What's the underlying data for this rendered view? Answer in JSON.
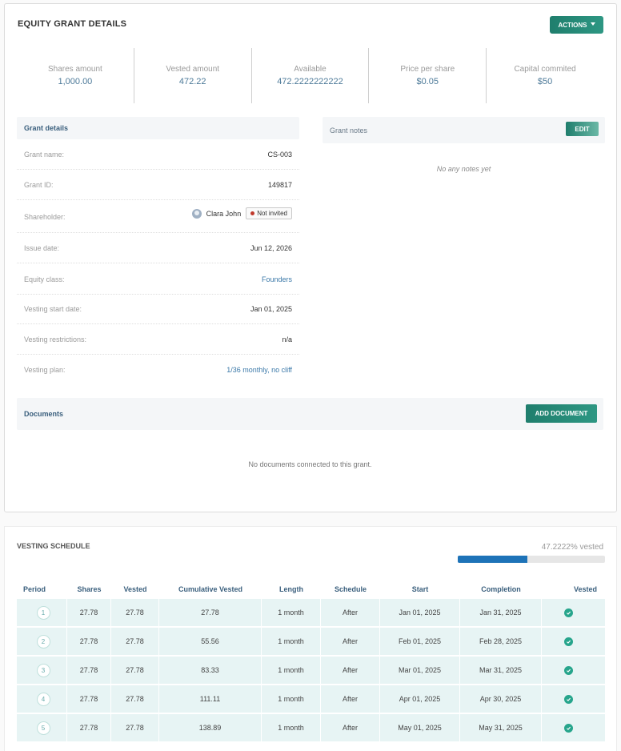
{
  "grant": {
    "title": "EQUITY GRANT DETAILS",
    "actions_label": "ACTIONS",
    "stats": [
      {
        "label": "Shares amount",
        "value": "1,000.00"
      },
      {
        "label": "Vested amount",
        "value": "472.22"
      },
      {
        "label": "Available",
        "value": "472.2222222222"
      },
      {
        "label": "Price per share",
        "value": "$0.05"
      },
      {
        "label": "Capital commited",
        "value": "$50"
      }
    ]
  },
  "details": {
    "title": "Grant details",
    "rows": {
      "name": {
        "label": "Grant name:",
        "value": "CS-003"
      },
      "id": {
        "label": "Grant ID:",
        "value": "149817"
      },
      "shareholder": {
        "label": "Shareholder:",
        "value": "Clara John",
        "badge": "Not invited"
      },
      "issue_date": {
        "label": "Issue date:",
        "value": "Jun 12, 2026"
      },
      "equity_class": {
        "label": "Equity class:",
        "value": "Founders"
      },
      "vesting_start": {
        "label": "Vesting start date:",
        "value": "Jan 01, 2025"
      },
      "vesting_restrictions": {
        "label": "Vesting restrictions:",
        "value": "n/a"
      },
      "vesting_plan": {
        "label": "Vesting plan:",
        "value": "1/36 monthly, no cliff"
      }
    }
  },
  "notes": {
    "title": "Grant notes",
    "edit_label": "EDIT",
    "empty_text": "No any notes yet"
  },
  "documents": {
    "title": "Documents",
    "add_label": "ADD DOCUMENT",
    "empty_text": "No documents connected to this grant."
  },
  "vesting": {
    "title": "VESTING SCHEDULE",
    "percent_label": "47.2222% vested",
    "progress": 0.472222,
    "columns": {
      "period": "Period",
      "shares": "Shares",
      "vested": "Vested",
      "cumulative": "Cumulative Vested",
      "length": "Length",
      "schedule": "Schedule",
      "start": "Start",
      "completion": "Completion",
      "vested_flag": "Vested"
    },
    "rows": [
      {
        "period": "1",
        "shares": "27.78",
        "vested": "27.78",
        "cumulative": "27.78",
        "length": "1 month",
        "schedule": "After",
        "start": "Jan 01, 2025",
        "completion": "Jan 31, 2025"
      },
      {
        "period": "2",
        "shares": "27.78",
        "vested": "27.78",
        "cumulative": "55.56",
        "length": "1 month",
        "schedule": "After",
        "start": "Feb 01, 2025",
        "completion": "Feb 28, 2025"
      },
      {
        "period": "3",
        "shares": "27.78",
        "vested": "27.78",
        "cumulative": "83.33",
        "length": "1 month",
        "schedule": "After",
        "start": "Mar 01, 2025",
        "completion": "Mar 31, 2025"
      },
      {
        "period": "4",
        "shares": "27.78",
        "vested": "27.78",
        "cumulative": "111.11",
        "length": "1 month",
        "schedule": "After",
        "start": "Apr 01, 2025",
        "completion": "Apr 30, 2025"
      },
      {
        "period": "5",
        "shares": "27.78",
        "vested": "27.78",
        "cumulative": "138.89",
        "length": "1 month",
        "schedule": "After",
        "start": "May 01, 2025",
        "completion": "May 31, 2025"
      }
    ]
  },
  "colors": {
    "accent": "#1f7e6d",
    "link": "#3a78a8",
    "progress": "#1e73b8",
    "row_bg": "#e7f4f4"
  }
}
